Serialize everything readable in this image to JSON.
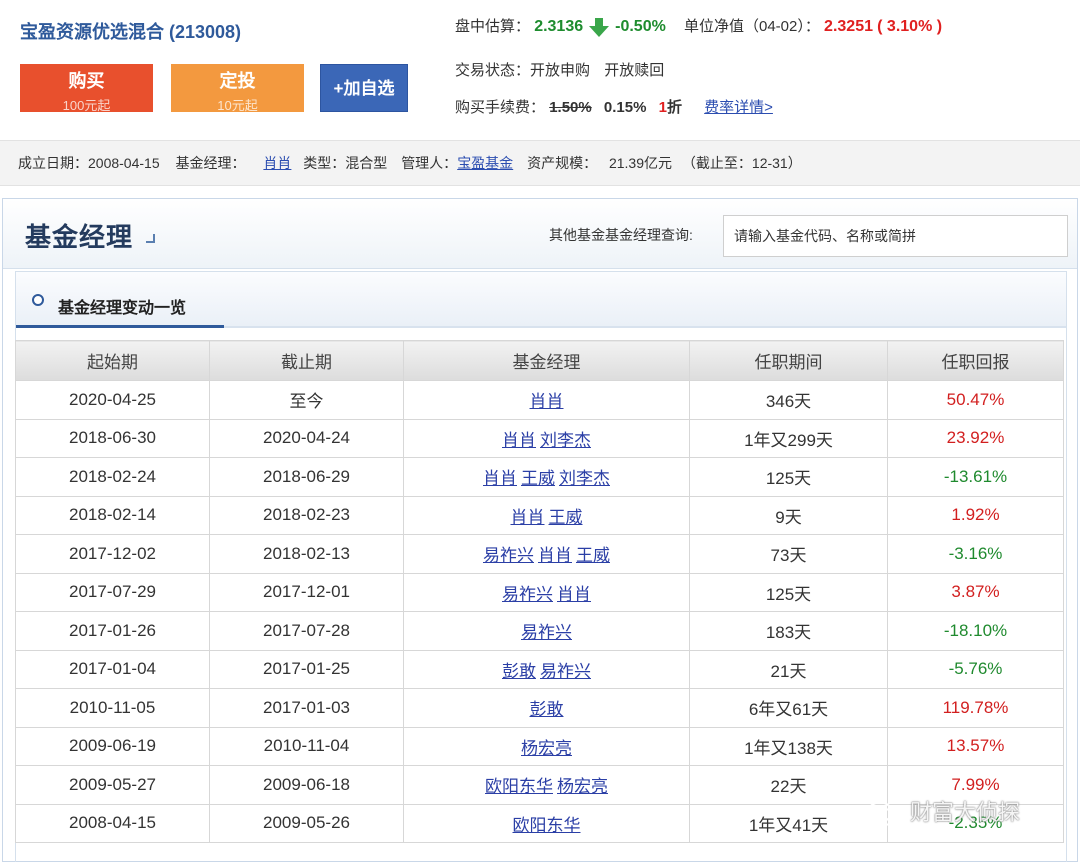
{
  "fund": {
    "title": "宝盈资源优选混合 (213008)",
    "buy_label": "购买",
    "buy_sub": "100元起",
    "plan_label": "定投",
    "plan_sub": "10元起",
    "watch_label": "+加自选"
  },
  "estimate": {
    "label": "盘中估算：",
    "value": "2.3136",
    "change": "-0.50%",
    "nav_label": "单位净值（04-02）：",
    "nav_value": "2.3251",
    "nav_change": "( 3.10% )",
    "arrow_icon": "down-arrow-icon"
  },
  "trade": {
    "status_label": "交易状态：",
    "status_buy": "开放申购",
    "status_redeem": "开放赎回",
    "fee_label": "购买手续费：",
    "fee_original": "1.50%",
    "fee_current": "0.15%",
    "fee_discount_num": "1",
    "fee_discount_unit": "折",
    "fee_detail_link": "费率详情>"
  },
  "info": {
    "established_label": "成立日期：",
    "established": "2008-04-15",
    "manager_label": "基金经理：",
    "manager": "肖肖",
    "type_label": "类型：",
    "type": "混合型",
    "company_label": "管理人：",
    "company": "宝盈基金",
    "size_label": "资产规模：",
    "size": "21.39亿元",
    "size_note": "（截止至：12-31）"
  },
  "section": {
    "title": "基金经理",
    "query_label": "其他基金基金经理查询:",
    "query_placeholder": "请输入基金代码、名称或简拼",
    "sub_title": "基金经理变动一览"
  },
  "table": {
    "headers": [
      "起始期",
      "截止期",
      "基金经理",
      "任职期间",
      "任职回报"
    ],
    "rows": [
      {
        "start": "2020-04-25",
        "end": "至今",
        "managers": [
          "肖肖"
        ],
        "period": "346天",
        "ret": "50.47%",
        "sign": "pos"
      },
      {
        "start": "2018-06-30",
        "end": "2020-04-24",
        "managers": [
          "肖肖",
          "刘李杰"
        ],
        "period": "1年又299天",
        "ret": "23.92%",
        "sign": "pos"
      },
      {
        "start": "2018-02-24",
        "end": "2018-06-29",
        "managers": [
          "肖肖",
          "王威",
          "刘李杰"
        ],
        "period": "125天",
        "ret": "-13.61%",
        "sign": "neg"
      },
      {
        "start": "2018-02-14",
        "end": "2018-02-23",
        "managers": [
          "肖肖",
          "王威"
        ],
        "period": "9天",
        "ret": "1.92%",
        "sign": "pos"
      },
      {
        "start": "2017-12-02",
        "end": "2018-02-13",
        "managers": [
          "易祚兴",
          "肖肖",
          "王威"
        ],
        "period": "73天",
        "ret": "-3.16%",
        "sign": "neg"
      },
      {
        "start": "2017-07-29",
        "end": "2017-12-01",
        "managers": [
          "易祚兴",
          "肖肖"
        ],
        "period": "125天",
        "ret": "3.87%",
        "sign": "pos"
      },
      {
        "start": "2017-01-26",
        "end": "2017-07-28",
        "managers": [
          "易祚兴"
        ],
        "period": "183天",
        "ret": "-18.10%",
        "sign": "neg"
      },
      {
        "start": "2017-01-04",
        "end": "2017-01-25",
        "managers": [
          "彭敢",
          "易祚兴"
        ],
        "period": "21天",
        "ret": "-5.76%",
        "sign": "neg"
      },
      {
        "start": "2010-11-05",
        "end": "2017-01-03",
        "managers": [
          "彭敢"
        ],
        "period": "6年又61天",
        "ret": "119.78%",
        "sign": "pos"
      },
      {
        "start": "2009-06-19",
        "end": "2010-11-04",
        "managers": [
          "杨宏亮"
        ],
        "period": "1年又138天",
        "ret": "13.57%",
        "sign": "pos"
      },
      {
        "start": "2009-05-27",
        "end": "2009-06-18",
        "managers": [
          "欧阳东华",
          "杨宏亮"
        ],
        "period": "22天",
        "ret": "7.99%",
        "sign": "pos"
      },
      {
        "start": "2008-04-15",
        "end": "2009-05-26",
        "managers": [
          "欧阳东华"
        ],
        "period": "1年又41天",
        "ret": "-2.35%",
        "sign": "neg"
      }
    ]
  },
  "watermark": {
    "text": "财富大侦探",
    "icon": "wechat-icon"
  },
  "colors": {
    "positive": "#d21f1f",
    "negative": "#1f8a2e",
    "brand": "#2f5a9b",
    "buy": "#e8502d",
    "plan": "#f3993f",
    "watch": "#3b67b7"
  }
}
